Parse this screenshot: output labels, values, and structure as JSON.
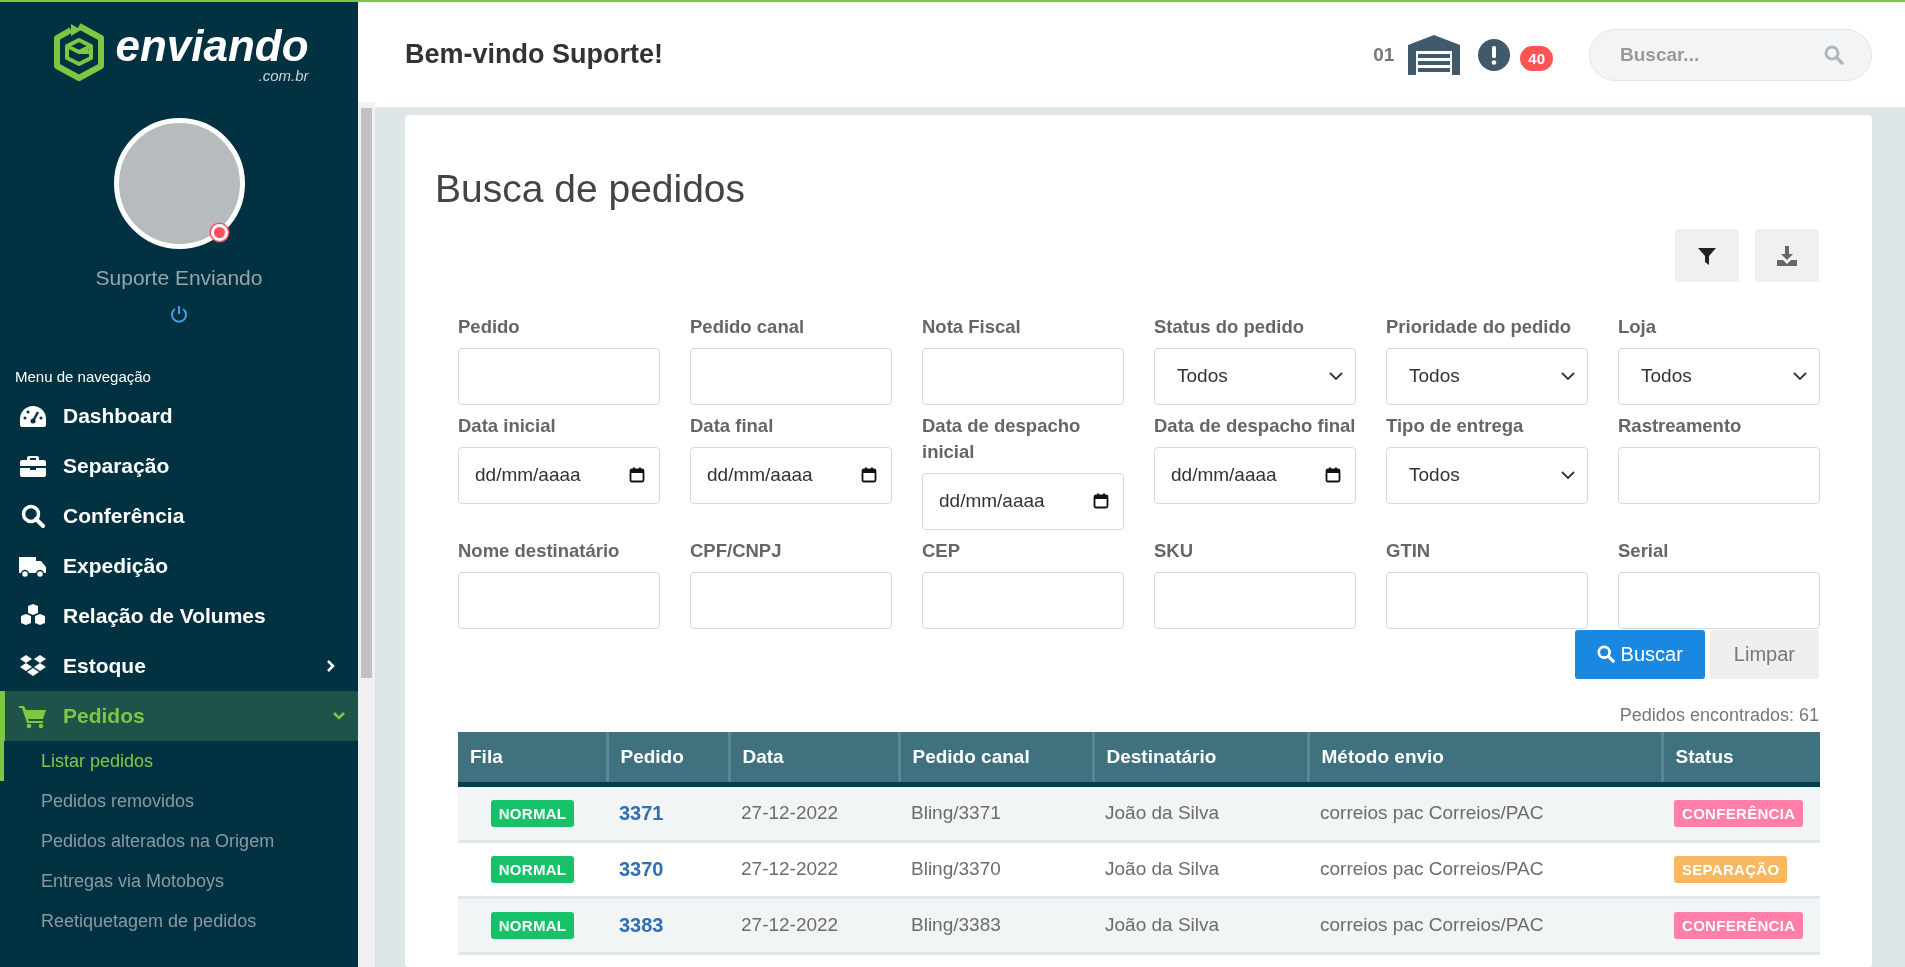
{
  "sidebar": {
    "logo": {
      "name": "enviando",
      "suffix": ".com.br"
    },
    "user": {
      "name": "Suporte Enviando"
    },
    "nav_title": "Menu de navegação",
    "nav": [
      {
        "label": "Dashboard",
        "kind": "link",
        "selected": false
      },
      {
        "label": "Separação",
        "kind": "link",
        "selected": false
      },
      {
        "label": "Conferência",
        "kind": "link",
        "selected": false
      },
      {
        "label": "Expedição",
        "kind": "link",
        "selected": false
      },
      {
        "label": "Relação de Volumes",
        "kind": "link",
        "selected": false
      },
      {
        "label": "Estoque",
        "kind": "group",
        "selected": false,
        "expanded": false
      },
      {
        "label": "Pedidos",
        "kind": "group",
        "selected": true,
        "expanded": true,
        "children": [
          {
            "label": "Listar pedidos",
            "selected": true
          },
          {
            "label": "Pedidos removidos",
            "selected": false
          },
          {
            "label": "Pedidos alterados na Origem",
            "selected": false
          },
          {
            "label": "Entregas via Motoboys",
            "selected": false
          },
          {
            "label": "Reetiquetagem de pedidos",
            "selected": false
          }
        ]
      }
    ]
  },
  "header": {
    "greeting": "Bem-vindo Suporte!",
    "warehouse_count": "01",
    "alerts_count": "40",
    "search": {
      "placeholder": "Buscar..."
    }
  },
  "page": {
    "title": "Busca de pedidos",
    "filters": [
      {
        "label": "Pedido",
        "kind": "text"
      },
      {
        "label": "Pedido canal",
        "kind": "text"
      },
      {
        "label": "Nota Fiscal",
        "kind": "text"
      },
      {
        "label": "Status do pedido",
        "kind": "select",
        "value": "Todos"
      },
      {
        "label": "Prioridade do pedido",
        "kind": "select",
        "value": "Todos"
      },
      {
        "label": "Loja",
        "kind": "select",
        "value": "Todos"
      },
      {
        "label": "Data inicial",
        "kind": "date",
        "placeholder": "dd/mm/aaaa"
      },
      {
        "label": "Data final",
        "kind": "date",
        "placeholder": "dd/mm/aaaa"
      },
      {
        "label": "Data de despacho inicial",
        "kind": "date",
        "placeholder": "dd/mm/aaaa"
      },
      {
        "label": "Data de despacho final",
        "kind": "date",
        "placeholder": "dd/mm/aaaa"
      },
      {
        "label": "Tipo de entrega",
        "kind": "select",
        "value": "Todos"
      },
      {
        "label": "Rastreamento",
        "kind": "text"
      },
      {
        "label": "Nome destinatário",
        "kind": "text"
      },
      {
        "label": "CPF/CNPJ",
        "kind": "text"
      },
      {
        "label": "CEP",
        "kind": "text"
      },
      {
        "label": "SKU",
        "kind": "text"
      },
      {
        "label": "GTIN",
        "kind": "text"
      },
      {
        "label": "Serial",
        "kind": "text"
      }
    ],
    "buttons": {
      "search": "Buscar",
      "clear": "Limpar"
    },
    "results_count": "Pedidos encontrados: 61",
    "table": {
      "columns": [
        "Fila",
        "Pedido",
        "Data",
        "Pedido canal",
        "Destinatário",
        "Método envio",
        "Status"
      ],
      "rows": [
        {
          "queue": "NORMAL",
          "order": "3371",
          "date": "27-12-2022",
          "channel_order": "Bling/3371",
          "recipient": "João da Silva",
          "shipping": "correios pac Correios/PAC",
          "status": {
            "label": "CONFERÊNCIA",
            "color": "#ff7fa6"
          }
        },
        {
          "queue": "NORMAL",
          "order": "3370",
          "date": "27-12-2022",
          "channel_order": "Bling/3370",
          "recipient": "João da Silva",
          "shipping": "correios pac Correios/PAC",
          "status": {
            "label": "SEPARAÇÃO",
            "color": "#f8b862"
          }
        },
        {
          "queue": "NORMAL",
          "order": "3383",
          "date": "27-12-2022",
          "channel_order": "Bling/3383",
          "recipient": "João da Silva",
          "shipping": "correios pac Correios/PAC",
          "status": {
            "label": "CONFERÊNCIA",
            "color": "#ff7fa6"
          }
        }
      ]
    }
  }
}
